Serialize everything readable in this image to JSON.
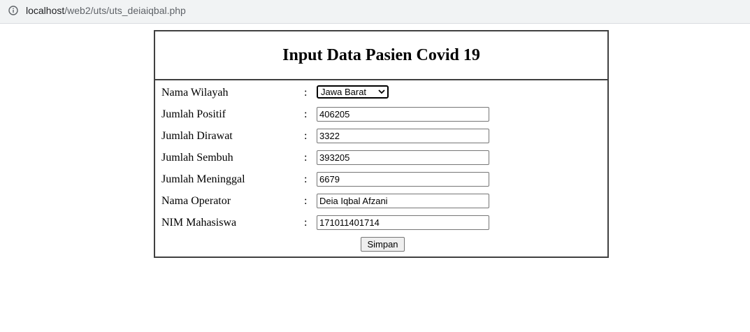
{
  "browser": {
    "url_host": "localhost",
    "url_path": "/web2/uts/uts_deiaiqbal.php"
  },
  "form": {
    "title": "Input Data Pasien Covid 19",
    "separator": ":",
    "fields": [
      {
        "label": "Nama Wilayah",
        "type": "select",
        "value": "Jawa Barat"
      },
      {
        "label": "Jumlah Positif",
        "type": "text",
        "value": "406205"
      },
      {
        "label": "Jumlah Dirawat",
        "type": "text",
        "value": "3322"
      },
      {
        "label": "Jumlah Sembuh",
        "type": "text",
        "value": "393205"
      },
      {
        "label": "Jumlah Meninggal",
        "type": "text",
        "value": "6679"
      },
      {
        "label": "Nama Operator",
        "type": "text",
        "value": "Deia Iqbal Afzani"
      },
      {
        "label": "NIM Mahasiswa",
        "type": "text",
        "value": "171011401714"
      }
    ],
    "submit_label": "Simpan"
  },
  "icons": {
    "address_info": "info-icon",
    "select_arrow": "chevron-down-icon"
  }
}
